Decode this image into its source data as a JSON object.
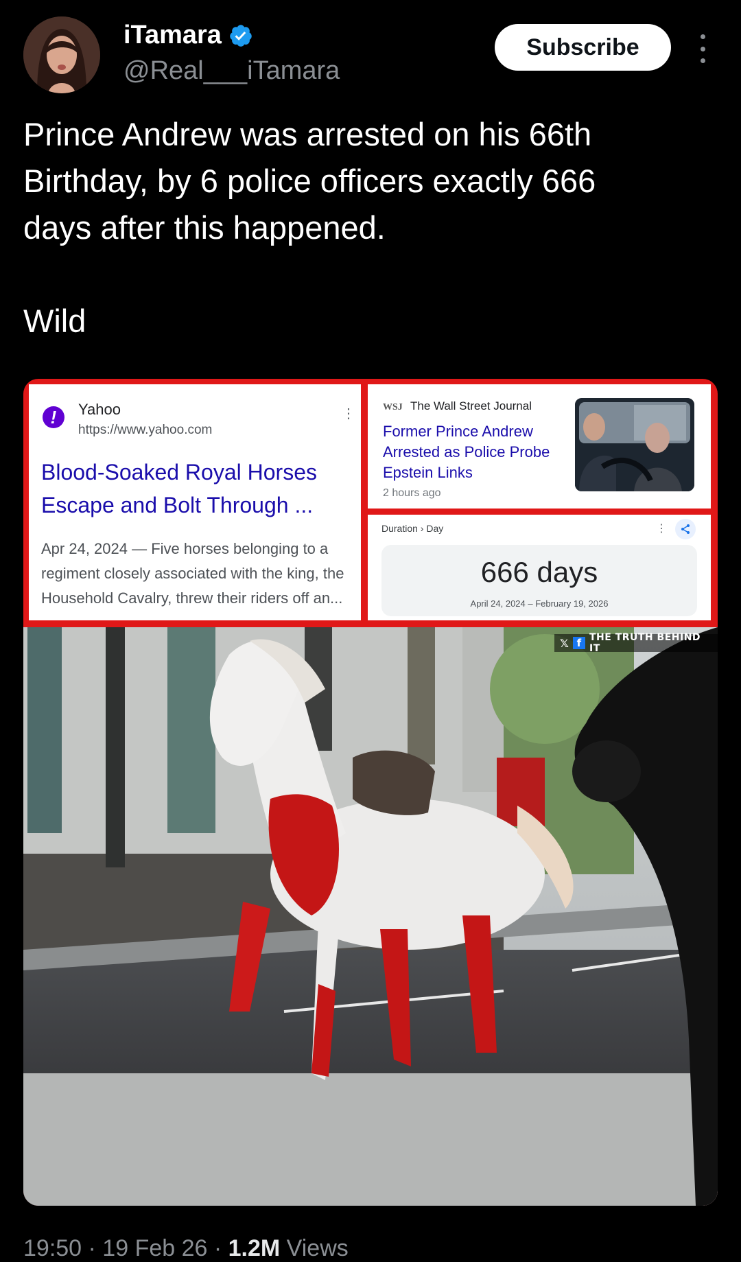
{
  "header": {
    "display_name": "iTamara",
    "handle": "@Real___iTamara",
    "subscribe_label": "Subscribe"
  },
  "tweet": {
    "text": "Prince Andrew was arrested on his 66th\nBirthday,  by 6 police officers exactly 666\ndays after this happened.\n\nWild"
  },
  "yahoo_result": {
    "site": "Yahoo",
    "url": "https://www.yahoo.com",
    "title": "Blood-Soaked Royal Horses Escape and Bolt Through ...",
    "snippet": "Apr 24, 2024 — Five horses belonging to a regiment closely associated with the king, the Household Cavalry, threw their riders off an..."
  },
  "wsj_result": {
    "logo": "WSJ",
    "site": "The Wall Street Journal",
    "title": "Former Prince Andrew Arrested as Police Probe Epstein Links",
    "time": "2 hours ago"
  },
  "duration_calc": {
    "breadcrumb": "Duration › Day",
    "value": "666 days",
    "range": "April 24, 2024 – February 19, 2026"
  },
  "photo": {
    "watermark": "THE TRUTH BEHIND IT"
  },
  "meta": {
    "time": "19:50 · 19 Feb 26 · ",
    "views_count": "1.2M",
    "views_label": " Views"
  },
  "colors": {
    "accent_red": "#e01818",
    "verified_blue": "#1d9bf0",
    "link_blue": "#1a0dab"
  }
}
